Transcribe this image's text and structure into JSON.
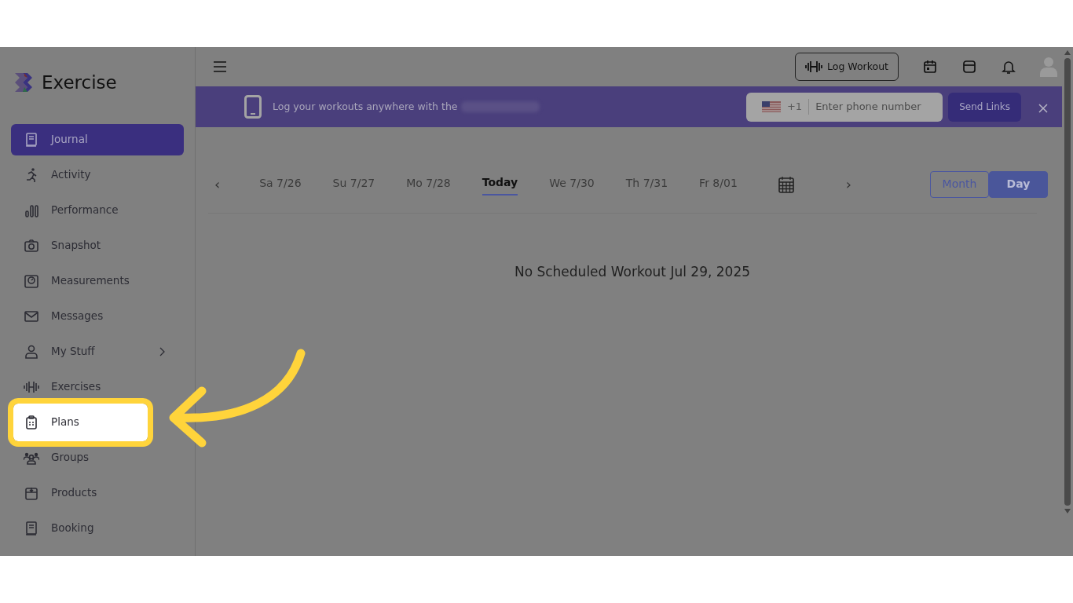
{
  "brand": {
    "name": "Exercise"
  },
  "sidebar": {
    "items": [
      {
        "label": "Journal",
        "selected": true,
        "highlighted": false,
        "has_submenu": false
      },
      {
        "label": "Activity",
        "selected": false,
        "highlighted": false,
        "has_submenu": false
      },
      {
        "label": "Performance",
        "selected": false,
        "highlighted": false,
        "has_submenu": false
      },
      {
        "label": "Snapshot",
        "selected": false,
        "highlighted": false,
        "has_submenu": false
      },
      {
        "label": "Measurements",
        "selected": false,
        "highlighted": false,
        "has_submenu": false
      },
      {
        "label": "Messages",
        "selected": false,
        "highlighted": false,
        "has_submenu": false
      },
      {
        "label": "My Stuff",
        "selected": false,
        "highlighted": false,
        "has_submenu": true
      },
      {
        "label": "Exercises",
        "selected": false,
        "highlighted": false,
        "has_submenu": false
      },
      {
        "label": "Plans",
        "selected": false,
        "highlighted": true,
        "has_submenu": false
      },
      {
        "label": "Groups",
        "selected": false,
        "highlighted": false,
        "has_submenu": false
      },
      {
        "label": "Products",
        "selected": false,
        "highlighted": false,
        "has_submenu": false
      },
      {
        "label": "Booking",
        "selected": false,
        "highlighted": false,
        "has_submenu": false
      }
    ]
  },
  "toolbar": {
    "log_button": "Log Workout"
  },
  "banner": {
    "text": "Log your workouts anywhere with the",
    "country_code": "+1",
    "phone_placeholder": "Enter phone number",
    "send_button": "Send Links"
  },
  "date_strip": {
    "prev": "‹",
    "next": "›",
    "days": [
      {
        "label": "Sa 7/26",
        "selected": false
      },
      {
        "label": "Su 7/27",
        "selected": false
      },
      {
        "label": "Mo 7/28",
        "selected": false
      },
      {
        "label": "Today",
        "selected": true
      },
      {
        "label": "We 7/30",
        "selected": false
      },
      {
        "label": "Th 7/31",
        "selected": false
      },
      {
        "label": "Fr 8/01",
        "selected": false
      }
    ]
  },
  "view_toggle": [
    {
      "label": "Month",
      "selected": false
    },
    {
      "label": "Day",
      "selected": true
    }
  ],
  "empty_message": "No Scheduled Workout Jul 29, 2025"
}
